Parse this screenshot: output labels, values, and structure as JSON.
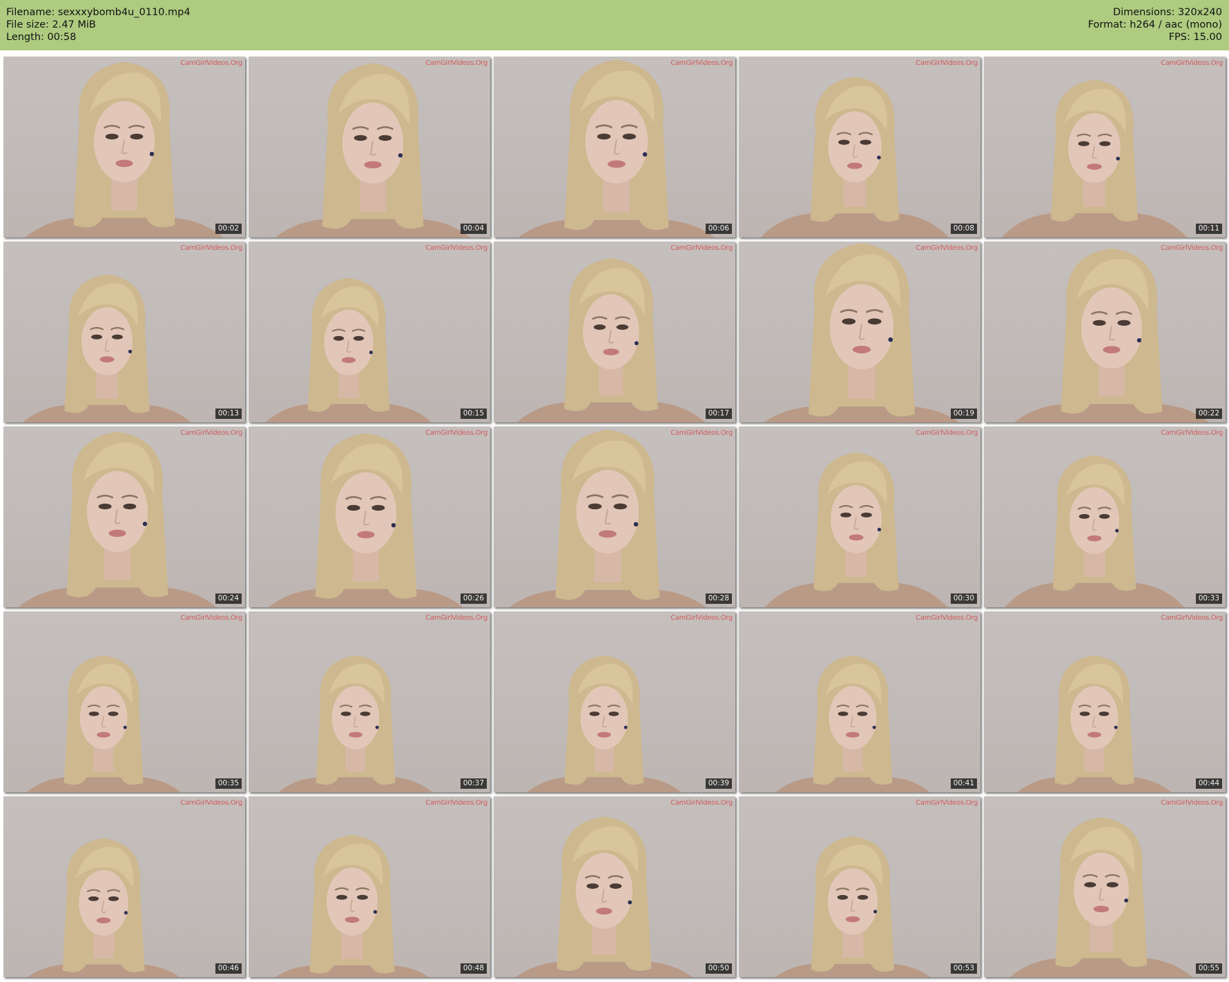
{
  "header": {
    "filename_line": "Filename: sexxxybomb4u_0110.mp4",
    "filesize_line": "File size: 2.47 MiB",
    "length_line": "Length: 00:58",
    "dimensions_line": "Dimensions: 320x240",
    "format_line": "Format: h264 / aac (mono)",
    "fps_line": "FPS: 15.00",
    "background_color": "#aecb80"
  },
  "thumbnails": {
    "watermark": "CamGirlVideos.Org",
    "timestamps": [
      "00:02",
      "00:04",
      "00:06",
      "00:08",
      "00:11",
      "00:13",
      "00:15",
      "00:17",
      "00:19",
      "00:22",
      "00:24",
      "00:26",
      "00:28",
      "00:30",
      "00:33",
      "00:35",
      "00:37",
      "00:39",
      "00:41",
      "00:44",
      "00:46",
      "00:48",
      "00:50",
      "00:53",
      "00:55"
    ]
  }
}
